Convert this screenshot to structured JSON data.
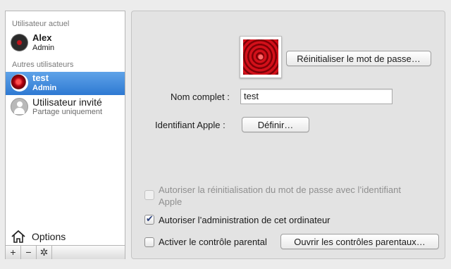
{
  "sidebar": {
    "current_user_header": "Utilisateur actuel",
    "current_user": {
      "name": "Alex",
      "role": "Admin"
    },
    "other_users_header": "Autres utilisateurs",
    "other_users": [
      {
        "name": "test",
        "role": "Admin"
      },
      {
        "name": "Utilisateur invité",
        "role": "Partage uniquement"
      }
    ],
    "options_label": "Options",
    "toolbar": {
      "add": "+",
      "remove": "−",
      "gear": "✲"
    }
  },
  "panel": {
    "reset_password_button": "Réinitialiser le mot de passe…",
    "full_name_label": "Nom complet :",
    "full_name_value": "test",
    "apple_id_label": "Identifiant Apple :",
    "define_button": "Définir…",
    "allow_reset_label": "Autoriser la réinitialisation du mot de passe avec l’identifiant",
    "allow_reset_label_2": "Apple",
    "allow_admin_label": "Autoriser l’administration de cet ordinateur",
    "parental_controls_label": "Activer le contrôle parental",
    "open_parental_button": "Ouvrir les contrôles parentaux…",
    "allow_reset_checked": false,
    "allow_admin_checked": true,
    "parental_controls_checked": false
  },
  "colors": {
    "selection": "#3a82d8",
    "window_bg": "#ececec"
  }
}
